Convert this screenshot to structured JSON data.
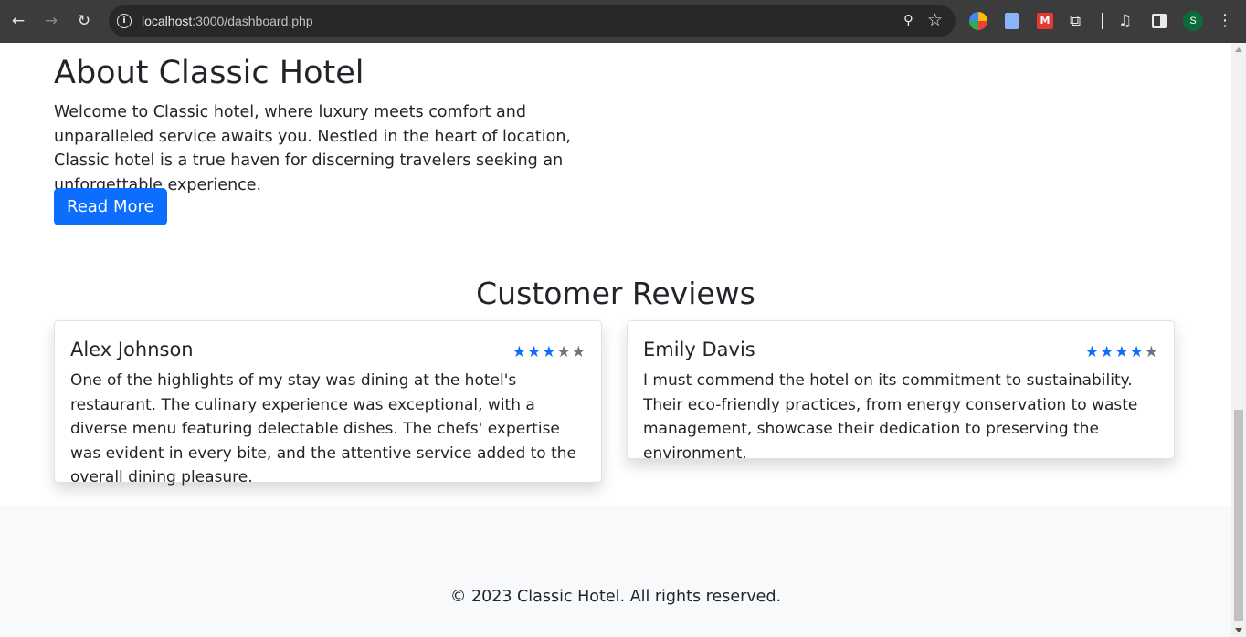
{
  "browser": {
    "url_host": "localhost",
    "url_path": ":3000/dashboard.php",
    "profile_initial": "S",
    "icons": {
      "back": "←",
      "forward": "→",
      "reload": "↻",
      "site_info": "i",
      "zoom": "⚲",
      "bookmark": "☆",
      "extensions": "⧉",
      "media": "♫",
      "menu": "⋮",
      "ext_red": "M"
    }
  },
  "about": {
    "title": "About Classic Hotel",
    "text": "Welcome to Classic hotel, where luxury meets comfort and unparalleled service awaits you. Nestled in the heart of location, Classic hotel is a true haven for discerning travelers seeking an unforgettable experience.",
    "button_label": "Read More"
  },
  "reviews": {
    "title": "Customer Reviews",
    "items": [
      {
        "name": "Alex Johnson",
        "rating": 3,
        "max_rating": 5,
        "text": "One of the highlights of my stay was dining at the hotel's restaurant. The culinary experience was exceptional, with a diverse menu featuring delectable dishes. The chefs' expertise was evident in every bite, and the attentive service added to the overall dining pleasure."
      },
      {
        "name": "Emily Davis",
        "rating": 4,
        "max_rating": 5,
        "text": "I must commend the hotel on its commitment to sustainability. Their eco-friendly practices, from energy conservation to waste management, showcase their dedication to preserving the environment."
      }
    ]
  },
  "footer": {
    "copyright": "© 2023 Classic Hotel. All rights reserved."
  },
  "colors": {
    "primary": "#0d6efd",
    "star_off": "#6c757d",
    "footer_bg": "#f8f9fa"
  }
}
